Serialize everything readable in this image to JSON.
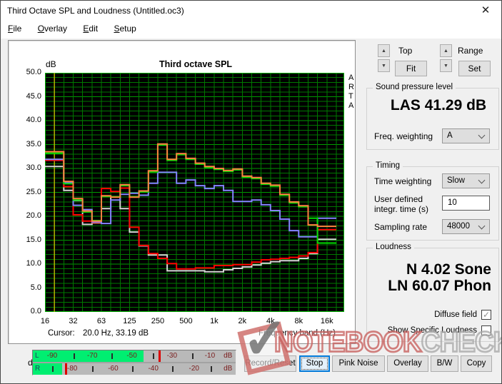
{
  "window": {
    "title": "Third Octave SPL and Loudness (Untitled.oc3)"
  },
  "icons": {
    "close": "✕",
    "spin_up": "▲",
    "spin_down": "▼",
    "check": "✓",
    "watermark_check": "✓"
  },
  "menu": {
    "items": [
      {
        "label": "File"
      },
      {
        "label": "Overlay"
      },
      {
        "label": "Edit"
      },
      {
        "label": "Setup"
      }
    ]
  },
  "scale_controls": {
    "top_label": "Top",
    "fit_button": "Fit",
    "range_label": "Range",
    "set_button": "Set"
  },
  "spl_group": {
    "group_label": "Sound pressure level",
    "value": "LAS 41.29 dB",
    "freq_weighting_label": "Freq. weighting",
    "freq_weighting_value": "A"
  },
  "timing_group": {
    "group_label": "Timing",
    "time_weighting_label": "Time weighting",
    "time_weighting_value": "Slow",
    "integr_label_line1": "User defined",
    "integr_label_line2": "integr. time (s)",
    "integr_value": "10",
    "sampling_label": "Sampling rate",
    "sampling_value": "48000"
  },
  "loudness_group": {
    "group_label": "Loudness",
    "sone_value": "N 4.02 Sone",
    "phon_value": "LN 60.07 Phon",
    "diffuse_label": "Diffuse field",
    "diffuse_checked": true,
    "specific_label": "Show Specific Loudness",
    "specific_checked": false
  },
  "meter": {
    "label": "dBFS",
    "rows": [
      {
        "channel": "L",
        "level_frac": 0.545,
        "peak_frac": 0.62,
        "labels": [
          {
            "text": "-90",
            "frac": 0.095
          },
          {
            "text": "-70",
            "frac": 0.293
          },
          {
            "text": "-50",
            "frac": 0.488
          },
          {
            "text": "-30",
            "frac": 0.686
          },
          {
            "text": "-10",
            "frac": 0.873
          },
          {
            "text": "dB",
            "frac": 0.962
          }
        ],
        "ticks": [
          0.2,
          0.389,
          0.59,
          0.784
        ]
      },
      {
        "channel": "R",
        "level_frac": 0.145,
        "peak_frac": 0.158,
        "labels": [
          {
            "text": "-80",
            "frac": 0.194
          },
          {
            "text": "-60",
            "frac": 0.396
          },
          {
            "text": "-40",
            "frac": 0.594
          },
          {
            "text": "-20",
            "frac": 0.795
          },
          {
            "text": "dB",
            "frac": 0.962
          }
        ],
        "ticks": [
          0.095,
          0.293,
          0.488,
          0.686,
          0.876
        ]
      }
    ]
  },
  "transport": {
    "buttons": [
      {
        "label": "Record/Reset",
        "focused": false
      },
      {
        "label": "Stop",
        "focused": true
      },
      {
        "label": "Pink Noise",
        "focused": false
      },
      {
        "label": "Overlay",
        "focused": false
      },
      {
        "label": "B/W",
        "focused": false
      },
      {
        "label": "Copy",
        "focused": false
      }
    ]
  },
  "watermark": {
    "text_red": "NOTEBOOK",
    "text_gray": "CHECK"
  },
  "chart_data": {
    "type": "line",
    "title": "Third octave SPL",
    "ylabel": "dB",
    "xlabel": "Frequency band (Hz)",
    "ylim": [
      0,
      50
    ],
    "grid": true,
    "legend_position": "none",
    "plot_bg": "#000000",
    "grid_color": "#007800",
    "grid_major_color": "#009c00",
    "border_color": "#00b000",
    "cursor_color": "#b4b400",
    "cursor_band_index": 1,
    "cursor_readout_label": "Cursor:",
    "cursor_readout": "20.0 Hz, 33.19 dB",
    "corner_text": "ARTA",
    "y_tick_labels": [
      "50.0",
      "45.0",
      "40.0",
      "35.0",
      "30.0",
      "25.0",
      "20.0",
      "15.0",
      "10.0",
      "5.0",
      "0.0"
    ],
    "x_tick_labels": [
      "16",
      "32",
      "63",
      "125",
      "250",
      "500",
      "1k",
      "2k",
      "4k",
      "8k",
      "16k"
    ],
    "categories": [
      "16",
      "20",
      "25",
      "31.5",
      "40",
      "50",
      "63",
      "80",
      "100",
      "125",
      "160",
      "200",
      "250",
      "315",
      "400",
      "500",
      "630",
      "800",
      "1k",
      "1.25k",
      "1.6k",
      "2k",
      "2.5k",
      "3.15k",
      "4k",
      "5k",
      "6.3k",
      "8k",
      "10k",
      "12.5k",
      "16k"
    ],
    "series": [
      {
        "name": "white",
        "color": "#d4d4d4",
        "values": [
          30.4,
          30.4,
          25.4,
          23.3,
          18.3,
          18.6,
          21.6,
          24.1,
          21.6,
          16.7,
          13.8,
          11.9,
          11.9,
          8.6,
          8.6,
          8.6,
          8.6,
          8.4,
          8.4,
          8.8,
          9.1,
          9.4,
          9.8,
          10.2,
          10.5,
          10.7,
          10.7,
          11.2,
          12.2,
          15.2,
          15.2
        ]
      },
      {
        "name": "red",
        "color": "#ff0000",
        "values": [
          31.7,
          31.7,
          26.2,
          20.3,
          19.0,
          18.7,
          25.8,
          25.2,
          25.9,
          17.7,
          13.9,
          12.2,
          11.2,
          10.1,
          9.0,
          9.0,
          9.2,
          9.2,
          9.7,
          9.7,
          9.9,
          9.9,
          10.4,
          10.9,
          11.0,
          11.2,
          11.4,
          11.7,
          12.4,
          17.2,
          17.2
        ]
      },
      {
        "name": "blue",
        "color": "#8484ff",
        "values": [
          31.9,
          31.9,
          27.0,
          22.3,
          21.4,
          18.8,
          18.5,
          23.4,
          24.6,
          24.8,
          24.4,
          26.9,
          29.2,
          29.2,
          26.9,
          27.6,
          26.4,
          25.8,
          26.4,
          25.4,
          23.1,
          23.1,
          23.4,
          22.4,
          21.2,
          19.4,
          17.0,
          15.7,
          15.7,
          19.6,
          19.6
        ]
      },
      {
        "name": "green",
        "color": "#00dd00",
        "values": [
          33.2,
          33.2,
          26.8,
          23.4,
          20.9,
          19.1,
          24.1,
          24.1,
          26.4,
          24.1,
          25.1,
          29.3,
          34.9,
          31.7,
          32.9,
          31.9,
          30.9,
          30.2,
          29.8,
          29.4,
          29.7,
          28.2,
          27.9,
          26.7,
          26.3,
          24.4,
          22.8,
          22.0,
          19.6,
          14.4,
          14.4
        ]
      },
      {
        "name": "orange",
        "color": "#ff8040",
        "values": [
          33.5,
          33.5,
          27.3,
          23.7,
          21.1,
          19.0,
          24.3,
          24.0,
          26.6,
          24.0,
          25.3,
          29.5,
          35.1,
          31.9,
          33.1,
          32.1,
          31.1,
          30.4,
          30.0,
          29.6,
          29.9,
          28.4,
          28.1,
          26.9,
          26.5,
          24.6,
          23.0,
          22.2,
          18.2,
          17.9,
          17.9
        ]
      }
    ]
  }
}
